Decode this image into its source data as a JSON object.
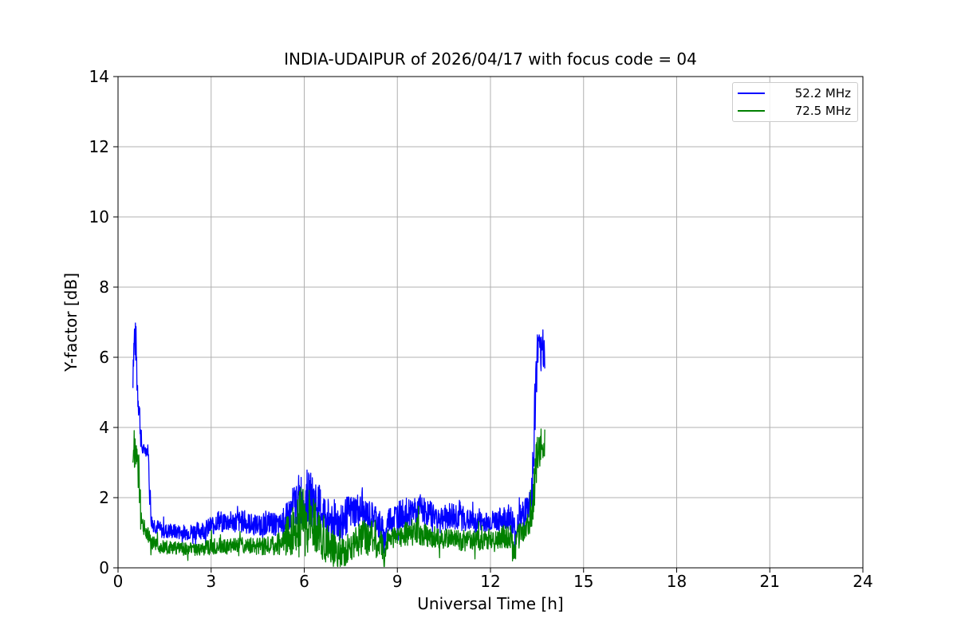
{
  "figure": {
    "background": "#ffffff",
    "grid_color": "#b0b0b0",
    "axes_color": "#000000",
    "text_color": "#000000"
  },
  "chart_data": {
    "type": "line",
    "title": "INDIA-UDAIPUR of 2026/04/17 with focus code = 04",
    "xlabel": "Universal Time [h]",
    "ylabel": "Y-factor [dB]",
    "xlim": [
      0,
      24
    ],
    "ylim": [
      0,
      14
    ],
    "xticks": [
      0,
      3,
      6,
      9,
      12,
      15,
      18,
      21,
      24
    ],
    "yticks": [
      0,
      2,
      4,
      6,
      8,
      10,
      12,
      14
    ],
    "grid": true,
    "legend": {
      "position": "upper right",
      "entries": [
        "52.2 MHz",
        "72.5 MHz"
      ]
    },
    "data_time_range_h": [
      0.48,
      13.75
    ],
    "sample_step_h": 0.01,
    "series": [
      {
        "name": "52.2 MHz",
        "color": "#0000ff",
        "t_start": 0.48,
        "t_end": 13.75,
        "envelope_points": [
          [
            0.48,
            5.6,
            0.6
          ],
          [
            0.53,
            6.55,
            0.65
          ],
          [
            0.58,
            6.3,
            0.6
          ],
          [
            0.62,
            5.2,
            0.7
          ],
          [
            0.68,
            4.6,
            0.5
          ],
          [
            0.73,
            3.8,
            0.4
          ],
          [
            0.78,
            3.35,
            0.18
          ],
          [
            0.97,
            3.35,
            0.18
          ],
          [
            1.02,
            2.2,
            0.5
          ],
          [
            1.08,
            1.3,
            0.25
          ],
          [
            1.4,
            1.05,
            0.22
          ],
          [
            2.2,
            1.0,
            0.22
          ],
          [
            2.9,
            1.1,
            0.28
          ],
          [
            3.2,
            1.35,
            0.3
          ],
          [
            3.6,
            1.3,
            0.3
          ],
          [
            4.0,
            1.3,
            0.32
          ],
          [
            4.4,
            1.2,
            0.3
          ],
          [
            4.8,
            1.3,
            0.35
          ],
          [
            5.2,
            1.2,
            0.3
          ],
          [
            5.5,
            1.45,
            0.5
          ],
          [
            5.8,
            1.95,
            0.75
          ],
          [
            6.1,
            2.0,
            0.8
          ],
          [
            6.4,
            1.8,
            0.75
          ],
          [
            6.7,
            1.5,
            0.55
          ],
          [
            7.0,
            1.35,
            0.6
          ],
          [
            7.2,
            1.3,
            0.65
          ],
          [
            7.45,
            1.55,
            0.5
          ],
          [
            7.7,
            1.65,
            0.5
          ],
          [
            8.0,
            1.5,
            0.45
          ],
          [
            8.3,
            1.45,
            0.4
          ],
          [
            8.5,
            1.0,
            0.55
          ],
          [
            8.58,
            0.7,
            0.4
          ],
          [
            8.7,
            1.35,
            0.4
          ],
          [
            9.0,
            1.5,
            0.4
          ],
          [
            9.35,
            1.6,
            0.42
          ],
          [
            9.7,
            1.65,
            0.4
          ],
          [
            10.0,
            1.55,
            0.38
          ],
          [
            10.35,
            1.45,
            0.35
          ],
          [
            10.7,
            1.45,
            0.4
          ],
          [
            10.95,
            1.5,
            0.5
          ],
          [
            11.2,
            1.35,
            0.32
          ],
          [
            11.6,
            1.3,
            0.3
          ],
          [
            12.0,
            1.3,
            0.3
          ],
          [
            12.4,
            1.4,
            0.35
          ],
          [
            12.65,
            1.45,
            0.4
          ],
          [
            12.78,
            0.85,
            0.65
          ],
          [
            12.88,
            1.3,
            0.4
          ],
          [
            13.1,
            1.55,
            0.4
          ],
          [
            13.3,
            1.85,
            0.55
          ],
          [
            13.38,
            2.8,
            1.0
          ],
          [
            13.45,
            5.0,
            1.2
          ],
          [
            13.52,
            6.2,
            0.6
          ],
          [
            13.6,
            6.1,
            0.55
          ],
          [
            13.68,
            6.2,
            0.5
          ],
          [
            13.75,
            6.1,
            0.45
          ]
        ]
      },
      {
        "name": "72.5 MHz",
        "color": "#008000",
        "t_start": 0.48,
        "t_end": 13.75,
        "envelope_points": [
          [
            0.48,
            3.1,
            0.6
          ],
          [
            0.53,
            3.4,
            0.65
          ],
          [
            0.58,
            3.3,
            0.6
          ],
          [
            0.63,
            3.1,
            0.6
          ],
          [
            0.68,
            2.6,
            0.7
          ],
          [
            0.73,
            1.5,
            0.45
          ],
          [
            0.78,
            1.15,
            0.25
          ],
          [
            0.9,
            1.1,
            0.25
          ],
          [
            1.0,
            0.85,
            0.25
          ],
          [
            1.1,
            0.7,
            0.2
          ],
          [
            1.4,
            0.6,
            0.2
          ],
          [
            2.0,
            0.55,
            0.18
          ],
          [
            2.6,
            0.55,
            0.2
          ],
          [
            3.0,
            0.62,
            0.25
          ],
          [
            3.5,
            0.6,
            0.22
          ],
          [
            4.0,
            0.62,
            0.25
          ],
          [
            4.5,
            0.6,
            0.25
          ],
          [
            5.0,
            0.65,
            0.28
          ],
          [
            5.3,
            0.7,
            0.35
          ],
          [
            5.6,
            1.1,
            0.8
          ],
          [
            5.9,
            1.3,
            1.0
          ],
          [
            6.2,
            1.25,
            0.95
          ],
          [
            6.5,
            0.95,
            0.7
          ],
          [
            6.8,
            0.7,
            0.6
          ],
          [
            7.0,
            0.45,
            0.45
          ],
          [
            7.2,
            0.4,
            0.4
          ],
          [
            7.4,
            0.55,
            0.45
          ],
          [
            7.6,
            0.75,
            0.45
          ],
          [
            7.9,
            0.85,
            0.5
          ],
          [
            8.2,
            0.9,
            0.55
          ],
          [
            8.45,
            0.7,
            0.5
          ],
          [
            8.58,
            0.35,
            0.35
          ],
          [
            8.7,
            0.8,
            0.3
          ],
          [
            9.0,
            0.9,
            0.32
          ],
          [
            9.4,
            1.0,
            0.38
          ],
          [
            9.7,
            1.05,
            0.4
          ],
          [
            10.0,
            0.92,
            0.32
          ],
          [
            10.4,
            0.85,
            0.3
          ],
          [
            10.8,
            0.8,
            0.3
          ],
          [
            11.2,
            0.78,
            0.3
          ],
          [
            11.6,
            0.78,
            0.3
          ],
          [
            12.0,
            0.82,
            0.3
          ],
          [
            12.4,
            0.88,
            0.33
          ],
          [
            12.65,
            0.9,
            0.35
          ],
          [
            12.78,
            0.4,
            0.38
          ],
          [
            12.88,
            0.95,
            0.3
          ],
          [
            13.1,
            1.05,
            0.35
          ],
          [
            13.3,
            1.35,
            0.5
          ],
          [
            13.38,
            1.8,
            0.6
          ],
          [
            13.45,
            2.8,
            0.7
          ],
          [
            13.52,
            3.4,
            0.6
          ],
          [
            13.6,
            3.45,
            0.55
          ],
          [
            13.68,
            3.5,
            0.5
          ],
          [
            13.75,
            3.5,
            0.5
          ]
        ]
      }
    ]
  }
}
